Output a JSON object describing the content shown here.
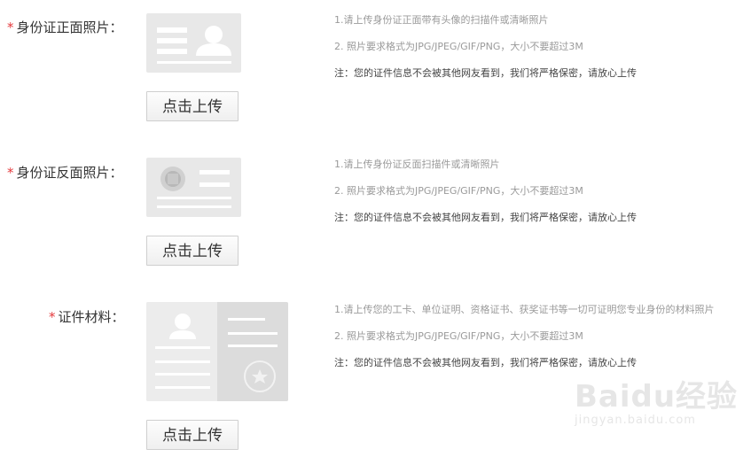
{
  "sections": [
    {
      "label": "身份证正面照片：",
      "button": "点击上传",
      "hints": [
        "1.请上传身份证正面带有头像的扫描件或清晰照片",
        "2. 照片要求格式为JPG/JPEG/GIF/PNG，大小不要超过3M",
        "注：您的证件信息不会被其他网友看到，我们将严格保密，请放心上传"
      ]
    },
    {
      "label": "身份证反面照片：",
      "button": "点击上传",
      "hints": [
        "1.请上传身份证反面扫描件或清晰照片",
        "2. 照片要求格式为JPG/JPEG/GIF/PNG，大小不要超过3M",
        "注：您的证件信息不会被其他网友看到，我们将严格保密，请放心上传"
      ]
    },
    {
      "label": "证件材料：",
      "button": "点击上传",
      "hints": [
        "1.请上传您的工卡、单位证明、资格证书、获奖证书等一切可证明您专业身份的材料照片",
        "2. 照片要求格式为JPG/JPEG/GIF/PNG，大小不要超过3M",
        "注：您的证件信息不会被其他网友看到，我们将严格保密，请放心上传"
      ]
    }
  ],
  "required_mark": "*",
  "watermark": {
    "brand": "Baidu经验",
    "url": "jingyan.baidu.com"
  },
  "colors": {
    "required": "#e4393c",
    "hint_gray": "#9a9a9a",
    "thumb_bg": "#e8e8e8"
  }
}
